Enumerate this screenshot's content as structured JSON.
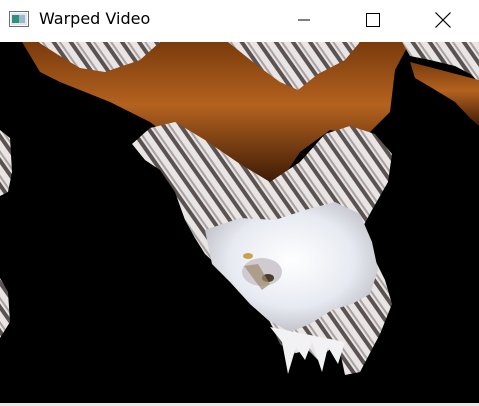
{
  "window": {
    "title": "Warped Video",
    "icon": "window-app-icon"
  },
  "controls": {
    "minimize_icon": "minimize-icon",
    "maximize_icon": "maximize-icon",
    "close_icon": "close-icon"
  },
  "video": {
    "content": "warped-video-frame"
  }
}
